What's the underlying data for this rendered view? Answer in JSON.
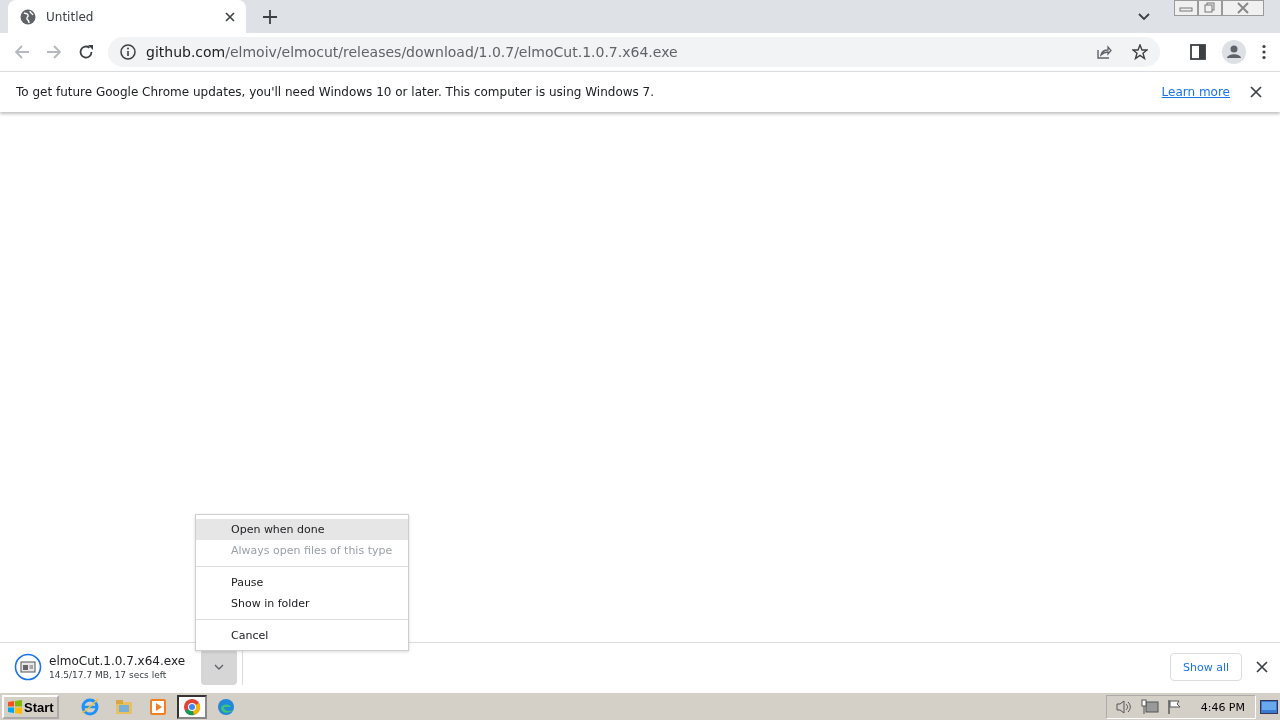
{
  "browser": {
    "tabs": [
      {
        "title": "Untitled",
        "selected": true
      }
    ],
    "address": {
      "host": "github.com",
      "path": "/elmoiv/elmocut/releases/download/1.0.7/elmoCut.1.0.7.x64.exe"
    }
  },
  "infobar": {
    "message": "To get future Google Chrome updates, you'll need Windows 10 or later. This computer is using Windows 7.",
    "link": "Learn more"
  },
  "context_menu": {
    "items": [
      {
        "kind": "item",
        "label": "Open when done",
        "disabled": false,
        "selected": true
      },
      {
        "kind": "item",
        "label": "Always open files of this type",
        "disabled": true,
        "selected": false
      },
      {
        "kind": "separator"
      },
      {
        "kind": "item",
        "label": "Pause",
        "disabled": false,
        "selected": false
      },
      {
        "kind": "item",
        "label": "Show in folder",
        "disabled": false,
        "selected": false
      },
      {
        "kind": "separator"
      },
      {
        "kind": "item",
        "label": "Cancel",
        "disabled": false,
        "selected": false
      }
    ]
  },
  "download_shelf": {
    "items": [
      {
        "filename": "elmoCut.1.0.7.x64.exe",
        "status": "14.5/17.7 MB, 17 secs left"
      }
    ],
    "show_all": "Show all"
  },
  "taskbar": {
    "start": "Start",
    "apps": [
      {
        "kind": "ie",
        "selected": false
      },
      {
        "kind": "explorer",
        "selected": false
      },
      {
        "kind": "media",
        "selected": false
      },
      {
        "kind": "chrome",
        "selected": true
      },
      {
        "kind": "edge",
        "selected": false
      }
    ],
    "clock": "4:46 PM"
  }
}
